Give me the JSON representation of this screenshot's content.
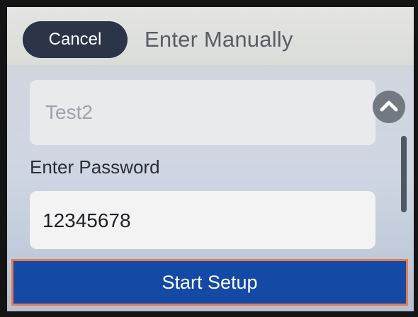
{
  "header": {
    "cancel_label": "Cancel",
    "title": "Enter Manually"
  },
  "ssid": {
    "value": "Test2"
  },
  "password": {
    "label": "Enter Password",
    "value": "12345678"
  },
  "footer": {
    "start_label": "Start Setup"
  },
  "colors": {
    "accent": "#1449a6",
    "focus_border": "#e47b52",
    "cancel_bg": "#2c3447"
  }
}
